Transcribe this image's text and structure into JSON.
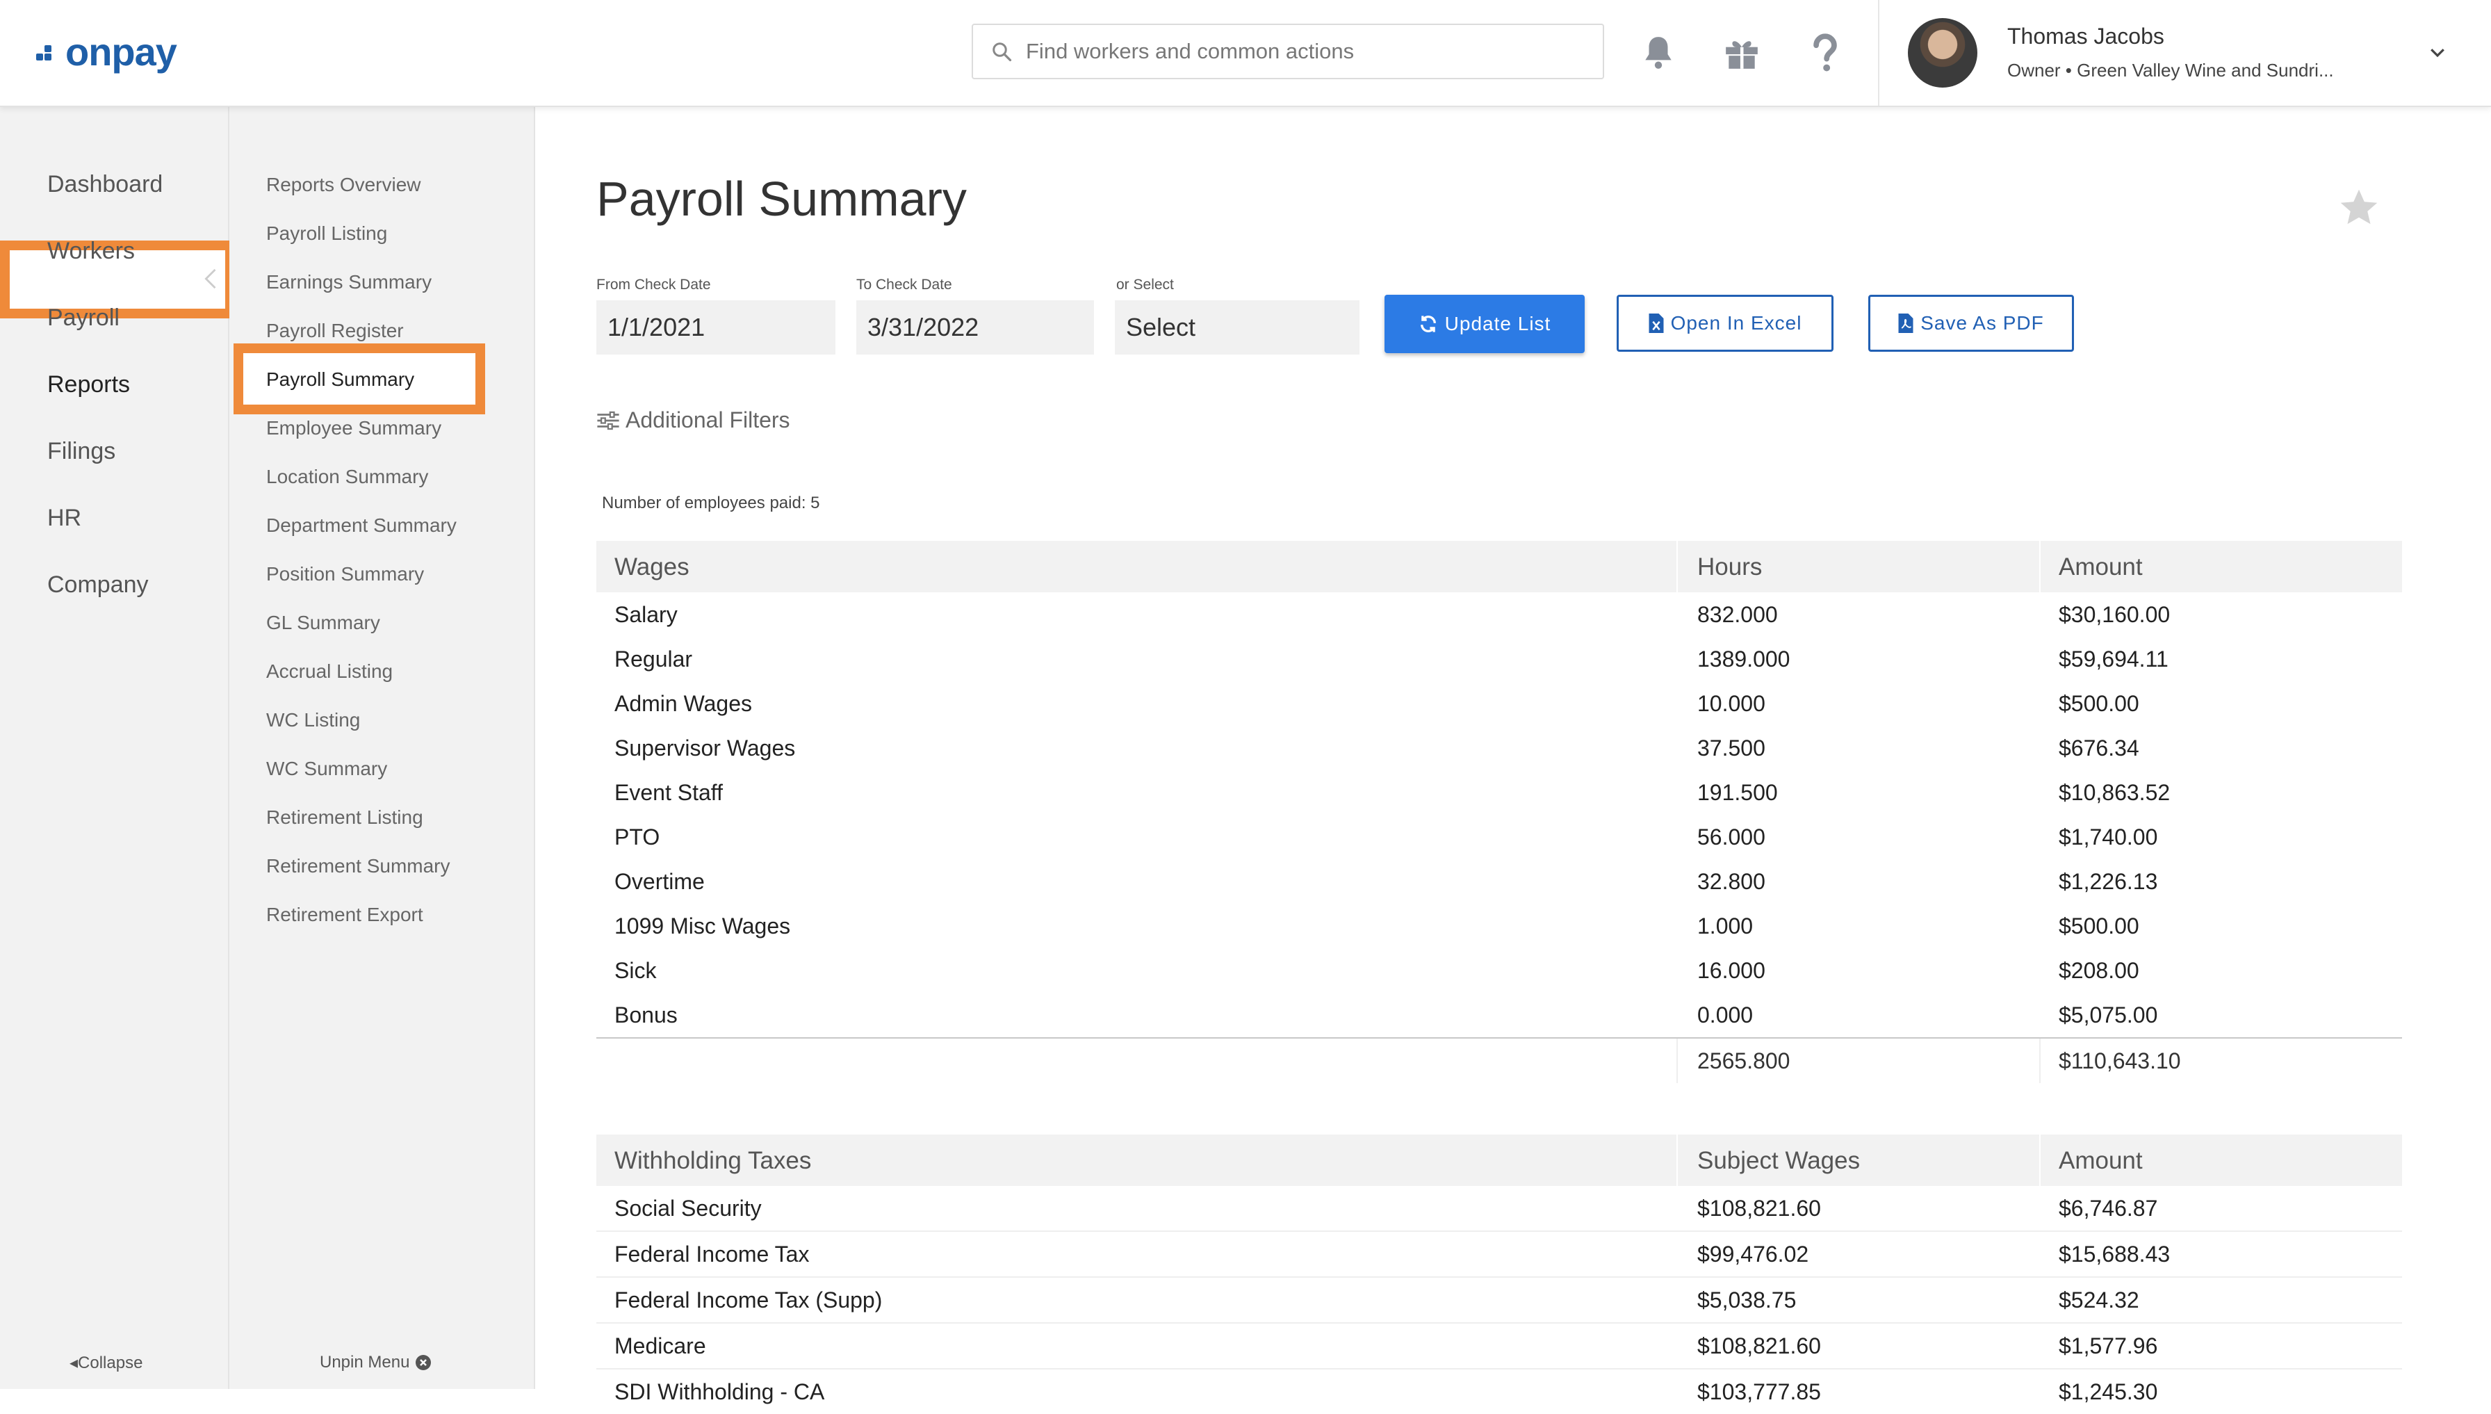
{
  "header": {
    "logo_text": "onpay",
    "search_placeholder": "Find workers and common actions",
    "user_name": "Thomas Jacobs",
    "user_role": "Owner • Green Valley Wine and Sundri..."
  },
  "primary_nav": {
    "items": [
      {
        "label": "Dashboard"
      },
      {
        "label": "Workers"
      },
      {
        "label": "Payroll"
      },
      {
        "label": "Reports",
        "active": true
      },
      {
        "label": "Filings"
      },
      {
        "label": "HR"
      },
      {
        "label": "Company"
      }
    ],
    "collapse_label": "Collapse"
  },
  "secondary_nav": {
    "items": [
      {
        "label": "Reports Overview"
      },
      {
        "label": "Payroll Listing"
      },
      {
        "label": "Earnings Summary"
      },
      {
        "label": "Payroll Register"
      },
      {
        "label": "Payroll Summary",
        "active": true
      },
      {
        "label": "Employee Summary"
      },
      {
        "label": "Location Summary"
      },
      {
        "label": "Department Summary"
      },
      {
        "label": "Position Summary"
      },
      {
        "label": "GL Summary"
      },
      {
        "label": "Accrual Listing"
      },
      {
        "label": "WC Listing"
      },
      {
        "label": "WC Summary"
      },
      {
        "label": "Retirement Listing"
      },
      {
        "label": "Retirement Summary"
      },
      {
        "label": "Retirement Export"
      }
    ],
    "unpin_label": "Unpin Menu"
  },
  "page": {
    "title": "Payroll Summary",
    "filters": {
      "from_label": "From Check Date",
      "from_value": "1/1/2021",
      "to_label": "To Check Date",
      "to_value": "3/31/2022",
      "select_label": "or Select",
      "select_value": "Select"
    },
    "buttons": {
      "update": "Update List",
      "excel": "Open In Excel",
      "pdf": "Save As PDF"
    },
    "additional_filters": "Additional Filters",
    "employees_paid": "Number of employees paid: 5"
  },
  "wages_table": {
    "headers": [
      "Wages",
      "Hours",
      "Amount"
    ],
    "rows": [
      [
        "Salary",
        "832.000",
        "$30,160.00"
      ],
      [
        "Regular",
        "1389.000",
        "$59,694.11"
      ],
      [
        "Admin Wages",
        "10.000",
        "$500.00"
      ],
      [
        "Supervisor Wages",
        "37.500",
        "$676.34"
      ],
      [
        "Event Staff",
        "191.500",
        "$10,863.52"
      ],
      [
        "PTO",
        "56.000",
        "$1,740.00"
      ],
      [
        "Overtime",
        "32.800",
        "$1,226.13"
      ],
      [
        "1099 Misc Wages",
        "1.000",
        "$500.00"
      ],
      [
        "Sick",
        "16.000",
        "$208.00"
      ],
      [
        "Bonus",
        "0.000",
        "$5,075.00"
      ]
    ],
    "total": [
      "",
      "2565.800",
      "$110,643.10"
    ]
  },
  "withholding_table": {
    "headers": [
      "Withholding Taxes",
      "Subject Wages",
      "Amount"
    ],
    "rows": [
      [
        "Social Security",
        "$108,821.60",
        "$6,746.87"
      ],
      [
        "Federal Income Tax",
        "$99,476.02",
        "$15,688.43"
      ],
      [
        "Federal Income Tax (Supp)",
        "$5,038.75",
        "$524.32"
      ],
      [
        "Medicare",
        "$108,821.60",
        "$1,577.96"
      ],
      [
        "SDI Withholding - CA",
        "$103,777.85",
        "$1,245.30"
      ]
    ]
  },
  "colors": {
    "brand": "#1f5fa8",
    "highlight": "#ef8a3a",
    "primary_button": "#2c7be5"
  }
}
